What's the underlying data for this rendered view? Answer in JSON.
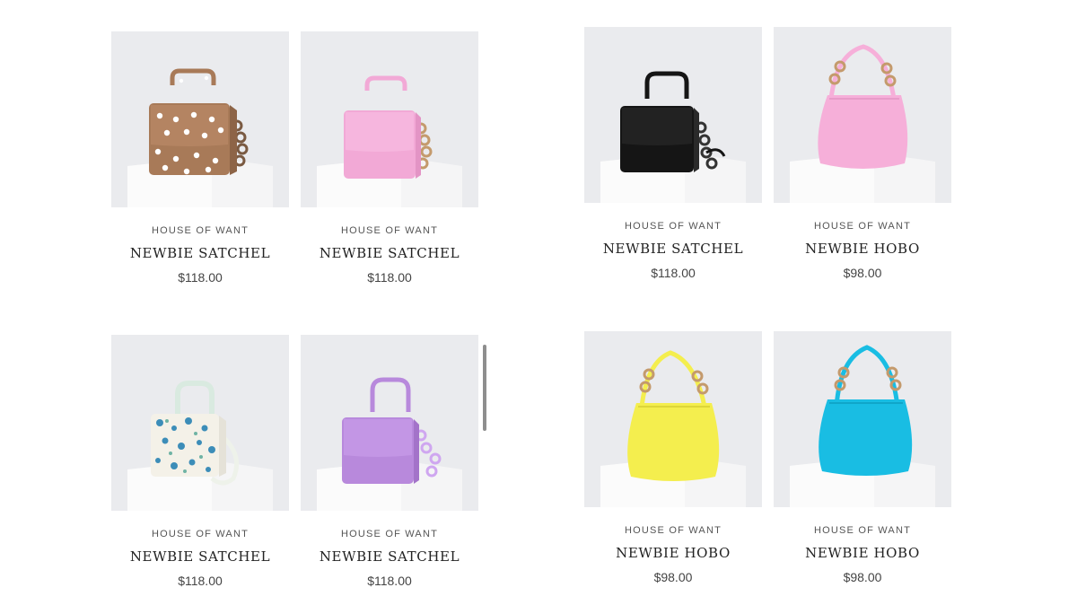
{
  "products": [
    {
      "brand": "HOUSE OF WANT",
      "name": "NEWBIE SATCHEL",
      "price": "$118.00",
      "image": "brown-polka-dot-satchel",
      "color": "#a87a58"
    },
    {
      "brand": "HOUSE OF WANT",
      "name": "NEWBIE SATCHEL",
      "price": "$118.00",
      "image": "pink-satchel",
      "color": "#f2a9d6"
    },
    {
      "brand": "HOUSE OF WANT",
      "name": "NEWBIE SATCHEL",
      "price": "$118.00",
      "image": "black-satchel",
      "color": "#151515"
    },
    {
      "brand": "HOUSE OF WANT",
      "name": "NEWBIE HOBO",
      "price": "$98.00",
      "image": "pink-hobo",
      "color": "#f6afd9"
    },
    {
      "brand": "HOUSE OF WANT",
      "name": "NEWBIE SATCHEL",
      "price": "$118.00",
      "image": "floral-satchel",
      "color": "#f4f1e8"
    },
    {
      "brand": "HOUSE OF WANT",
      "name": "NEWBIE SATCHEL",
      "price": "$118.00",
      "image": "lavender-satchel",
      "color": "#b889dc"
    },
    {
      "brand": "HOUSE OF WANT",
      "name": "NEWBIE HOBO",
      "price": "$98.00",
      "image": "yellow-hobo",
      "color": "#f4ee4e"
    },
    {
      "brand": "HOUSE OF WANT",
      "name": "NEWBIE HOBO",
      "price": "$98.00",
      "image": "turquoise-hobo",
      "color": "#19bde3"
    }
  ]
}
